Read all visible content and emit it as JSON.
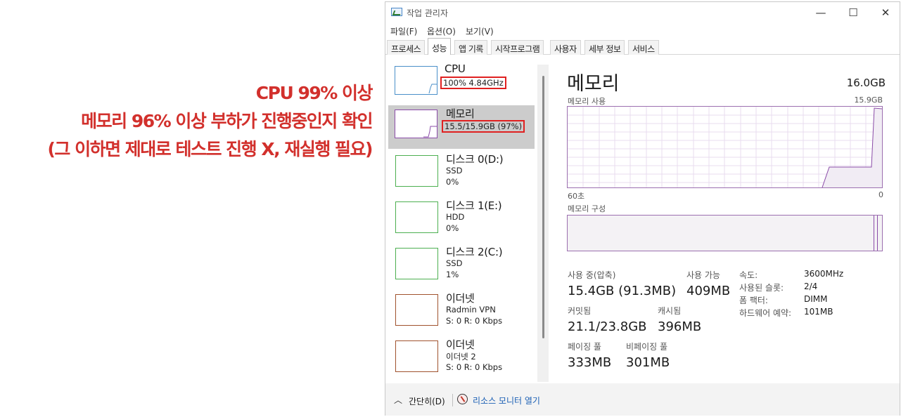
{
  "annotation": {
    "lines": [
      "CPU 99% 이상",
      "메모리 96% 이상 부하가 진행중인지 확인",
      "(그 이하면 제대로 테스트 진행 X, 재실행 필요)"
    ],
    "color": "#d2302c"
  },
  "window": {
    "title": "작업 관리자",
    "controls": {
      "minimize": "—",
      "maximize": "☐",
      "close": "✕"
    }
  },
  "menu": [
    "파일(F)",
    "옵션(O)",
    "보기(V)"
  ],
  "tabs": [
    {
      "label": "프로세스"
    },
    {
      "label": "성능",
      "active": true
    },
    {
      "label": "앱 기록"
    },
    {
      "label": "시작프로그램"
    },
    {
      "label": "사용자"
    },
    {
      "label": "세부 정보"
    },
    {
      "label": "서비스"
    }
  ],
  "resources": [
    {
      "name": "CPU",
      "sub1": "100% 4.84GHz",
      "sub2": "",
      "color": "#4a8fc9"
    },
    {
      "name": "메모리",
      "sub1": "15.5/15.9GB (97%)",
      "sub2": "",
      "color": "#8b4ca8",
      "selected": true
    },
    {
      "name": "디스크 0(D:)",
      "sub1": "SSD",
      "sub2": "0%",
      "color": "#4caf50"
    },
    {
      "name": "디스크 1(E:)",
      "sub1": "HDD",
      "sub2": "0%",
      "color": "#4caf50"
    },
    {
      "name": "디스크 2(C:)",
      "sub1": "SSD",
      "sub2": "1%",
      "color": "#4caf50"
    },
    {
      "name": "이더넷",
      "sub1": "Radmin VPN",
      "sub2": "S: 0 R: 0 Kbps",
      "color": "#a0522d"
    },
    {
      "name": "이더넷",
      "sub1": "이더넷 2",
      "sub2": "S: 0 R: 0 Kbps",
      "color": "#a0522d"
    }
  ],
  "detail": {
    "title": "메모리",
    "total": "16.0GB",
    "usage_label": "메모리 사용",
    "usage_max": "15.9GB",
    "time_left": "60초",
    "time_right": "0",
    "composition_label": "메모리 구성",
    "stats": {
      "in_use_label": "사용 중(압축)",
      "in_use_value": "15.4GB (91.3MB)",
      "available_label": "사용 가능",
      "available_value": "409MB",
      "committed_label": "커밋됨",
      "committed_value": "21.1/23.8GB",
      "cached_label": "캐시됨",
      "cached_value": "396MB",
      "paged_label": "페이징 풀",
      "paged_value": "333MB",
      "nonpaged_label": "비페이징 풀",
      "nonpaged_value": "301MB"
    },
    "specs": [
      {
        "k": "속도:",
        "v": "3600MHz"
      },
      {
        "k": "사용된 슬롯:",
        "v": "2/4"
      },
      {
        "k": "폼 팩터:",
        "v": "DIMM"
      },
      {
        "k": "하드웨어 예약:",
        "v": "101MB"
      }
    ]
  },
  "footer": {
    "collapse": "간단히(D)",
    "monitor": "리소스 모니터 열기"
  },
  "colors": {
    "memory": "#8b4ca8",
    "highlight": "#e02020"
  }
}
